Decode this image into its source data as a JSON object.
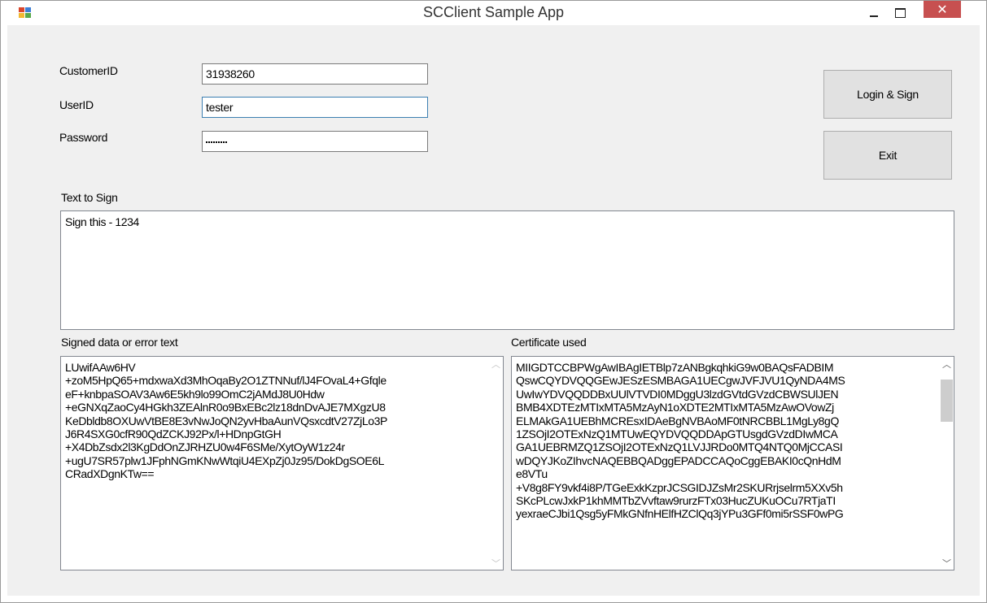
{
  "window": {
    "title": "SCClient Sample App",
    "controls": {
      "minimize": "–",
      "maximize": "□",
      "close": "✕"
    },
    "icon": "app-icon"
  },
  "form": {
    "customer_id": {
      "label": "CustomerID",
      "value": "31938260"
    },
    "user_id": {
      "label": "UserID",
      "value": "tester"
    },
    "password": {
      "label": "Password",
      "masked_length": 9
    },
    "login_button": "Login & Sign",
    "exit_button": "Exit",
    "text_to_sign": {
      "label": "Text to Sign",
      "value": "Sign this - 1234"
    },
    "signed_data": {
      "label": "Signed data or error text",
      "value": "LUwifAAw6HV\n+zoM5HpQ65+mdxwaXd3MhOqaBy2O1ZTNNuf/lJ4FOvaL4+Gfqle\neF+knbpaSOAV3Aw6E5kh9lo99OmC2jAMdJ8U0Hdw\n+eGNXqZaoCy4HGkh3ZEAlnR0o9BxEBc2lz18dnDvAJE7MXgzU8\nKeDbldb8OXUwVtBE8E3vNwJoQN2yvHbaAunVQsxcdtV27ZjLo3P\nJ6R4SXG0cfR90QdZCKJ92Px/l+HDnpGtGH\n+X4DbZsdx2l3KgDdOnZJRHZU0w4F6SMe/XytOyW1z24r\n+ugU7SR57plw1JFphNGmKNwWtqiU4EXpZj0Jz95/DokDgSOE6L\nCRadXDgnKTw=="
    },
    "certificate": {
      "label": "Certificate used",
      "value": "MIIGDTCCBPWgAwIBAgIETBlp7zANBgkqhkiG9w0BAQsFADBIM\nQswCQYDVQQGEwJESzESMBAGA1UECgwJVFJVU1QyNDA4MS\nUwIwYDVQQDDBxUUlVTVDI0MDggU3lzdGVtdGVzdCBWSUlJEN\nBMB4XDTEzMTIxMTA5MzAyN1oXDTE2MTIxMTA5MzAwOVowZj\nELMAkGA1UEBhMCREsxIDAeBgNVBAoMF0tNRCBBL1MgLy8gQ\n1ZSOjI2OTExNzQ1MTUwEQYDVQQDDApGTUsgdGVzdDIwMCA\nGA1UEBRMZQ1ZSOjI2OTExNzQ1LVJJRDo0MTQ4NTQ0MjCCASI\nwDQYJKoZIhvcNAQEBBQADggEPADCCAQoCggEBAKI0cQnHdM\ne8VTu\n+V8g8FY9vkf4i8P/TGeExkKzprJCSGIDJZsMr2SKURrjselrm5XXv5h\nSKcPLcwJxkP1khMMTbZVvftaw9rurzFTx03HucZUKuOCu7RTjaTI\nyexraeCJbi1Qsg5yFMkGNfnHElfHZClQq3jYPu3GFf0mi5rSSF0wPG"
    }
  }
}
